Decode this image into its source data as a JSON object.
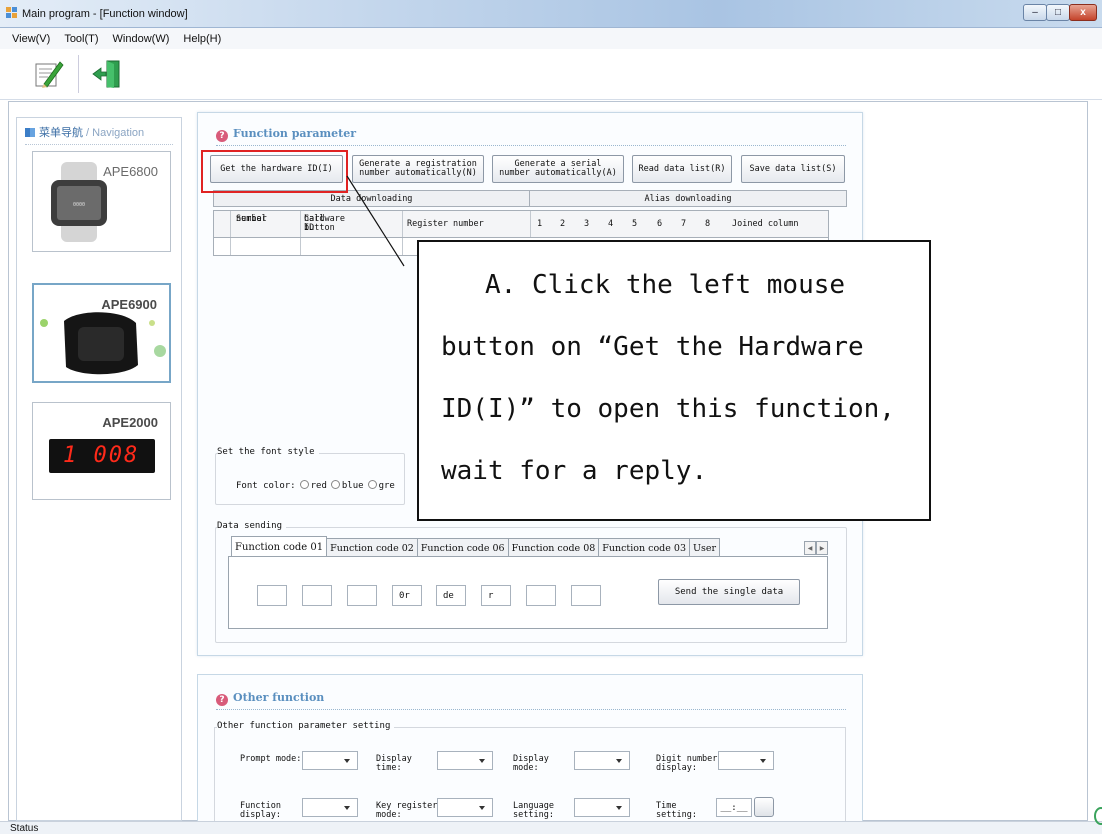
{
  "window": {
    "title": "Main program - [Function window]",
    "controls": {
      "minimize": "–",
      "maximize": "□",
      "close": "x"
    }
  },
  "menu": [
    "View(V)",
    "Tool(T)",
    "Window(W)",
    "Help(H)"
  ],
  "toolbar": {
    "icons": [
      "edit-icon",
      "exit-icon"
    ]
  },
  "navigation": {
    "title_cn": "菜单导航",
    "title_sep": " / ",
    "title_en": "Navigation",
    "cards": [
      {
        "label": "APE6800"
      },
      {
        "label": "APE6900",
        "selected": true
      },
      {
        "label": "APE2000",
        "display": "1 008"
      }
    ]
  },
  "function_parameter": {
    "title": "Function parameter",
    "buttons": {
      "get_hw_id": "Get the hardware ID(I)",
      "gen_reg_1": "Generate a registration",
      "gen_reg_2": "number automatically(N)",
      "gen_ser_1": "Generate a serial",
      "gen_ser_2": "number automatically(A)",
      "read": "Read data list(R)",
      "save": "Save data list(S)"
    },
    "grid_groups": [
      "Data downloading",
      "Alias downloading"
    ],
    "columns": {
      "serial_1": "Serial",
      "serial_2": "number",
      "callbtn_1": "Call button",
      "callbtn_2": "hardware ID",
      "register": "Register number",
      "alias": [
        "1",
        "2",
        "3",
        "4",
        "5",
        "6",
        "7",
        "8"
      ],
      "joined": "Joined column"
    },
    "font_style": {
      "title": "Set the font style",
      "label": "Font color:",
      "options": [
        "red",
        "blue",
        "gre"
      ]
    },
    "data_sending": {
      "title": "Data sending",
      "tabs": [
        "Function code 01",
        "Function code 02",
        "Function code 06",
        "Function code 08",
        "Function code 03",
        "User"
      ],
      "fields": [
        "",
        "",
        "",
        "0r",
        "de",
        "r",
        "",
        ""
      ],
      "send_button": "Send the single data"
    }
  },
  "callout": {
    "lines": [
      "A. Click the left mouse",
      "button on “Get the Hardware",
      "ID(I)” to open this function,",
      "wait for a reply."
    ]
  },
  "other_function": {
    "title": "Other function",
    "group_title": "Other function parameter setting",
    "row1": [
      {
        "l1": "Prompt mode:",
        "l2": ""
      },
      {
        "l1": "Display",
        "l2": "time:"
      },
      {
        "l1": "Display",
        "l2": "mode:"
      },
      {
        "l1": "Digit number",
        "l2": "display:"
      }
    ],
    "row2": [
      {
        "l1": "Function",
        "l2": "display:"
      },
      {
        "l1": "Key register",
        "l2": "mode:"
      },
      {
        "l1": "Language",
        "l2": "setting:"
      },
      {
        "l1": "Time",
        "l2": "setting:"
      }
    ],
    "time_value": "__:__"
  },
  "status": {
    "text": "Status"
  }
}
